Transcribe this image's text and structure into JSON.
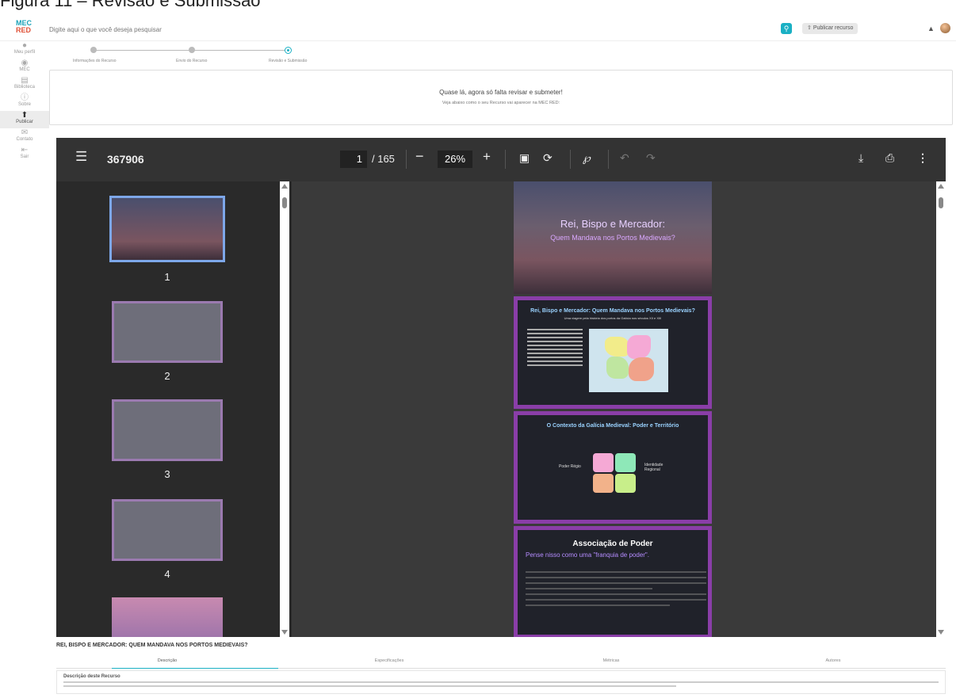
{
  "figure_caption": "Figura 11 – Revisão e Submissão",
  "header": {
    "logo_top": "MEC",
    "logo_bottom": "RED",
    "search_placeholder": "Digite aqui o que você deseja pesquisar",
    "publish_label": "Publicar recurso"
  },
  "sidebar": {
    "items": [
      {
        "label": "Meu perfil",
        "icon": "user-icon"
      },
      {
        "label": "MEC",
        "icon": "mec-icon"
      },
      {
        "label": "Biblioteca",
        "icon": "library-icon"
      },
      {
        "label": "Sobre",
        "icon": "info-icon"
      },
      {
        "label": "Publicar",
        "icon": "upload-icon",
        "active": true
      },
      {
        "label": "Contato",
        "icon": "mail-icon"
      },
      {
        "label": "Sair",
        "icon": "logout-icon"
      }
    ]
  },
  "stepper": {
    "steps": [
      "Informações do Recurso",
      "Envio do Recurso",
      "Revisão e Submissão"
    ],
    "current": 3
  },
  "notice": {
    "title": "Quase lá, agora só falta revisar e submeter!",
    "subtitle": "Veja abaixo como o seu Recurso vai aparecer na MEC RED:"
  },
  "viewer": {
    "doc_id": "367906",
    "page_current": "1",
    "page_total": "/ 165",
    "zoom": "26%"
  },
  "thumbnails": [
    {
      "num": "1",
      "selected": true
    },
    {
      "num": "2"
    },
    {
      "num": "3"
    },
    {
      "num": "4"
    }
  ],
  "slides": {
    "s1_title": "Rei, Bispo e Mercador:",
    "s1_subtitle": "Quem Mandava nos Portos Medievais?",
    "s2_title": "Rei, Bispo e Mercador: Quem Mandava nos Portos Medievais?",
    "s2_subtitle": "Uma viagem pela história dos portos da Galícia nos séculos XII e XIII",
    "s3_title": "O Contexto da Galícia Medieval: Poder e Território",
    "s3_label_left": "Poder Régio",
    "s3_label_right": "Identidade Regional",
    "s4_title": "Associação de Poder",
    "s4_subtitle": "Pense nisso como uma \"franquia de poder\"."
  },
  "resource": {
    "title": "REI, BISPO E MERCADOR: QUEM MANDAVA NOS PORTOS MEDIEVAIS?",
    "tabs": [
      "Descrição",
      "Especificações",
      "Métricas",
      "Autores"
    ],
    "desc_heading": "Descrição deste Recurso"
  },
  "colors": {
    "accent": "#1ab0c4",
    "selected_thumb": "#7da7e9",
    "slide_frame": "#8a3ea8"
  }
}
